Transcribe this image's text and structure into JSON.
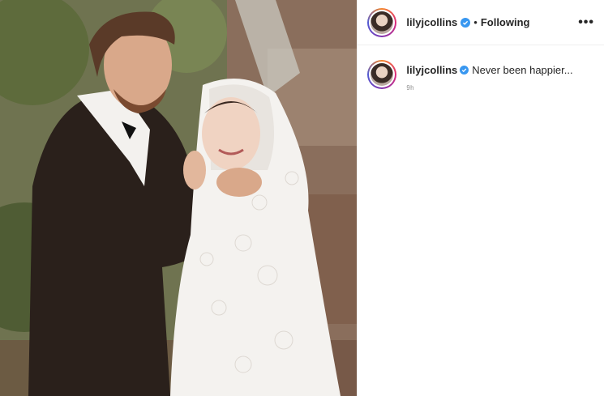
{
  "post": {
    "username": "lilyjcollins",
    "follow_separator": "•",
    "follow_label": "Following",
    "more_label": "•••",
    "caption": {
      "username": "lilyjcollins",
      "text": "Never been happier...",
      "time": "9h"
    }
  },
  "colors": {
    "verified": "#3897f0",
    "text": "#262626",
    "muted": "#8e8e8e"
  },
  "icons": {
    "verified": "verified-badge-icon",
    "more": "more-options-icon"
  }
}
